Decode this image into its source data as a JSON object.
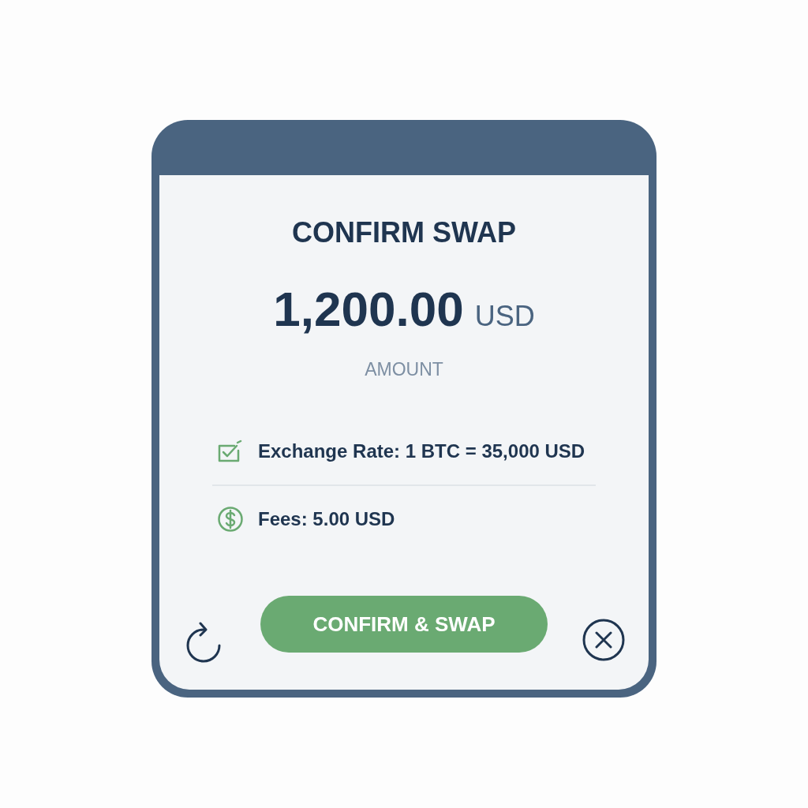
{
  "dialog": {
    "title": "CONFIRM SWAP",
    "amount": "1,200.00",
    "currency": "USD",
    "amount_label": "AMOUNT"
  },
  "details": [
    {
      "kind": "rate",
      "text": "Exchange Rate: 1 BTC = 35,000 USD"
    },
    {
      "kind": "fee",
      "text": "Fees: 5.00 USD"
    }
  ],
  "confirm_button": "CONFIRM & SWAP"
}
